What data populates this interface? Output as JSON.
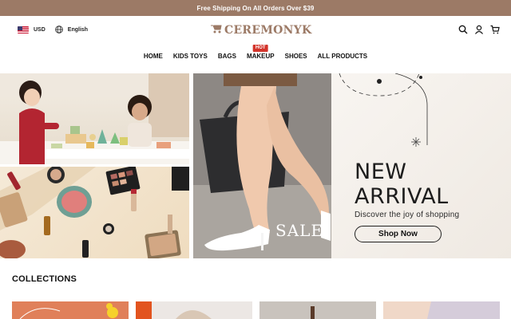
{
  "announcement": "Free Shipping On All Orders Over $39",
  "header": {
    "currency": "USD",
    "language": "English",
    "logo_text": "CEREMONYK"
  },
  "nav": {
    "items": [
      "HOME",
      "KIDS TOYS",
      "BAGS",
      "MAKEUP",
      "SHOES",
      "ALL PRODUCTS"
    ],
    "hot_badge": "HOT"
  },
  "hero": {
    "sale_text": "SALE",
    "arrival_line1": "NEW",
    "arrival_line2": "ARRIVAL",
    "arrival_subtitle": "Discover the joy of shopping",
    "shop_button": "Shop Now"
  },
  "collections": {
    "title": "COLLECTIONS"
  },
  "colors": {
    "brand": "#9c7a66",
    "hot_badge": "#d3342b"
  },
  "icons": [
    "us-flag-icon",
    "globe-icon",
    "stroller-logo-icon",
    "search-icon",
    "user-icon",
    "cart-icon"
  ]
}
